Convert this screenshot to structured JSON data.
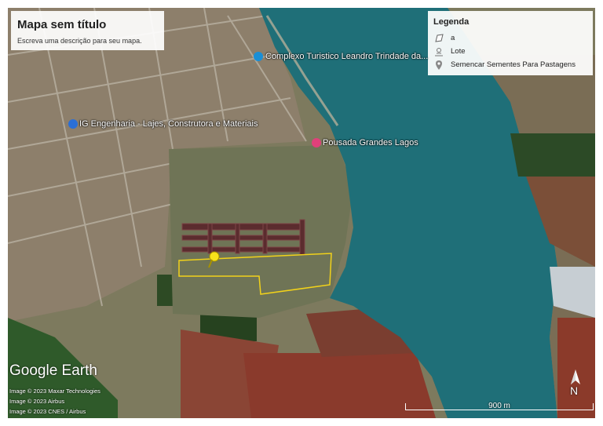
{
  "map": {
    "title": "Mapa sem título",
    "description": "Escreva uma descrição para seu mapa."
  },
  "legend": {
    "heading": "Legenda",
    "items": [
      {
        "icon": "polygon-icon",
        "label": "a"
      },
      {
        "icon": "lot-icon",
        "label": "Lote"
      },
      {
        "icon": "placemark-icon",
        "label": "Semencar Sementes Para Pastagens"
      }
    ]
  },
  "places": [
    {
      "name": "Complexo Turistico Leandro Trindade da...",
      "icon": "camera-icon",
      "color": "#1a8fd6"
    },
    {
      "name": "IG Engenharia - Lajes, Construtora e Materiais",
      "icon": "shop-icon",
      "color": "#2a6fd6"
    },
    {
      "name": "Pousada Grandes Lagos",
      "icon": "bed-icon",
      "color": "#e0407a"
    }
  ],
  "branding": {
    "logo": "Google Earth",
    "credits": [
      "Image © 2023 Maxar Technologies",
      "Image © 2023 Airbus",
      "Image © 2023 CNES / Airbus"
    ]
  },
  "scale": {
    "label": "900 m"
  },
  "compass": {
    "label": "N"
  },
  "colors": {
    "water": "#1f6f78",
    "urban": "#8a7a66",
    "field_red": "#8a3f2e",
    "selected_outline": "#f2d21a"
  }
}
